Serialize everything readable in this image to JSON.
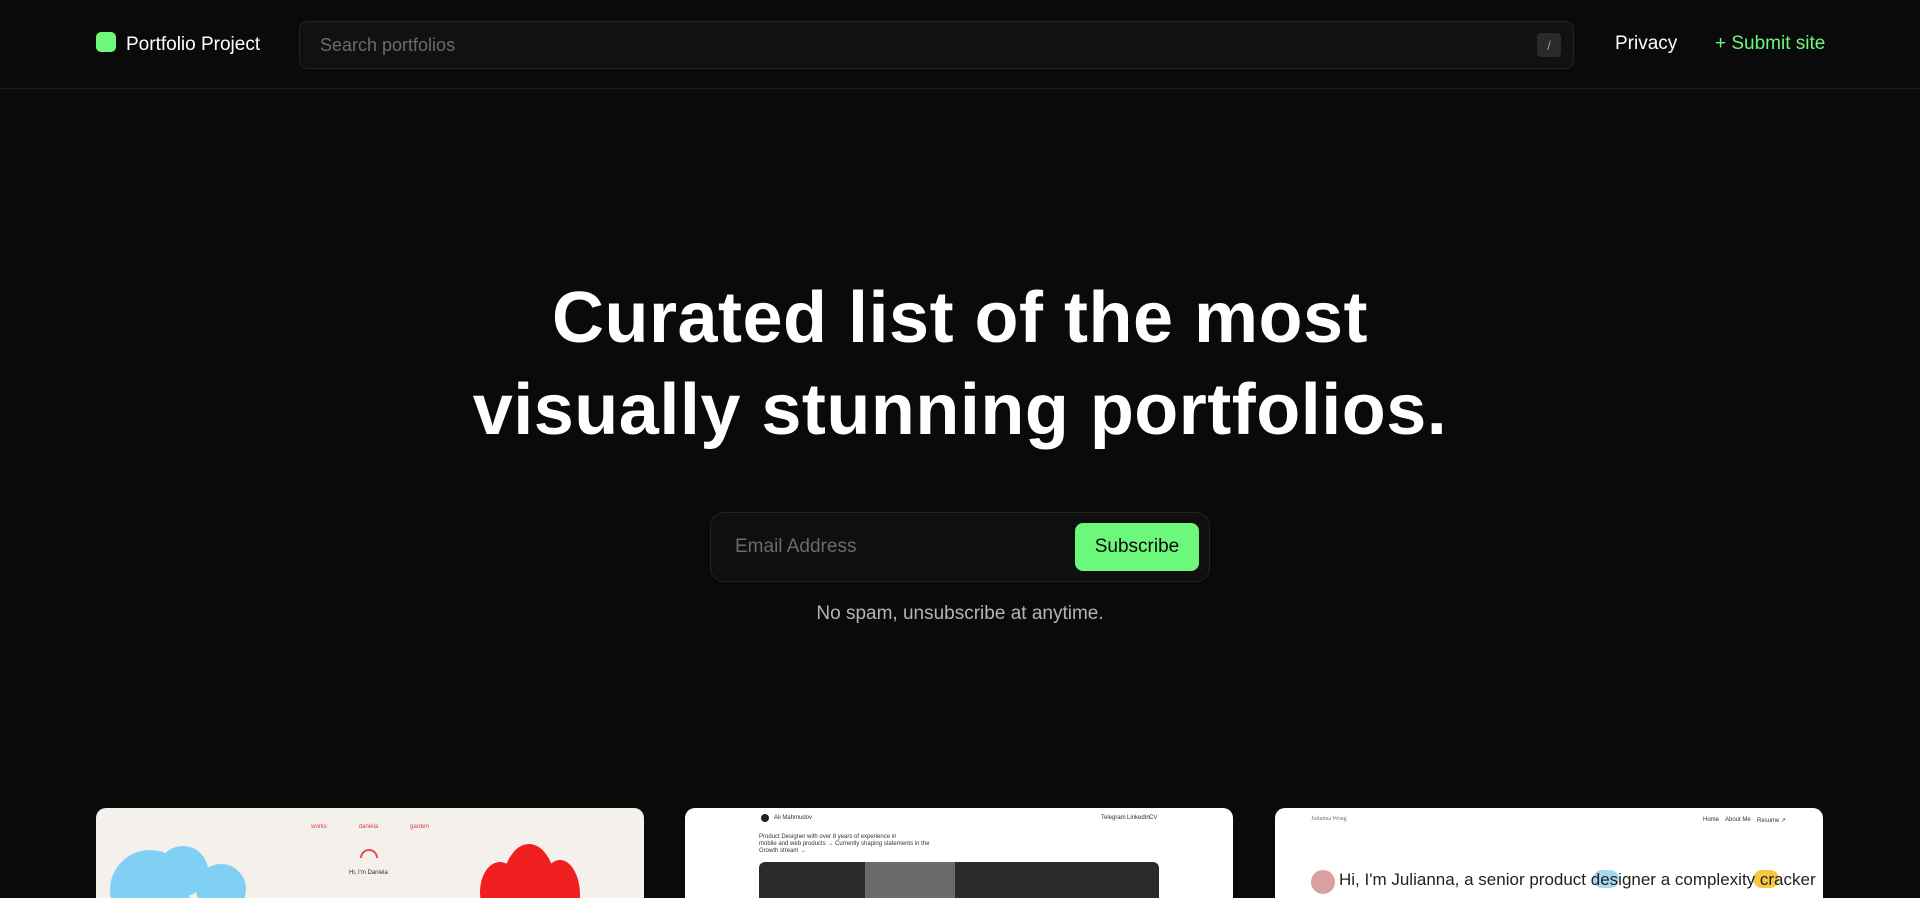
{
  "header": {
    "logo_text": "Portfolio Project",
    "search_placeholder": "Search portfolios",
    "search_shortcut": "/",
    "nav": {
      "privacy": "Privacy",
      "submit": "+ Submit site"
    }
  },
  "hero": {
    "title_line1": "Curated list of the most",
    "title_line2": "visually stunning portfolios.",
    "email_placeholder": "Email Address",
    "subscribe_label": "Subscribe",
    "hint": "No spam, unsubscribe at anytime."
  },
  "cards": [
    {
      "nav": [
        "works",
        "daniela",
        "garden"
      ],
      "intro": "Hi, I'm Daniela"
    },
    {
      "author": "Ali Mahmudov",
      "links": [
        "Telegram",
        "LinkedIn",
        "CV"
      ],
      "bio_line1": "Product Designer with over 8 years of experience in",
      "bio_line2": "mobile and web products → Currently shaping statements in the",
      "bio_line3": "Growth stream →"
    },
    {
      "author": "Julianna Wong",
      "links": [
        "Home",
        "About Me",
        "Resume ↗"
      ],
      "headline": "Hi, I'm Julianna, a senior product designer        a complexity cracker"
    }
  ],
  "colors": {
    "background": "#0a0a0a",
    "accent": "#6cf87a"
  }
}
